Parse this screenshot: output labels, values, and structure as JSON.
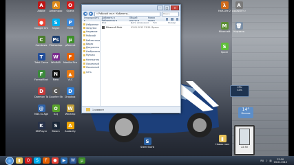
{
  "desktop": {
    "icons": [
      {
        "label": "Adobe",
        "glyph": "A",
        "color": "#c01616"
      },
      {
        "label": "Ashampoo",
        "glyph": "A",
        "color": "#e08b1a"
      },
      {
        "label": "Opera",
        "glyph": "O",
        "color": "#d01a1a"
      },
      {
        "label": "Google Chrome",
        "glyph": "●",
        "color": "#e94335"
      },
      {
        "label": "Skype",
        "glyph": "S",
        "color": "#00aff0"
      },
      {
        "label": "Paint",
        "glyph": "P",
        "color": "#3d88d6"
      },
      {
        "label": "Camtasia",
        "glyph": "C",
        "color": "#4a7d2e"
      },
      {
        "label": "Photoshop",
        "glyph": "Ps",
        "color": "#1b3e6f"
      },
      {
        "label": "µTorrent",
        "glyph": "µ",
        "color": "#3e8f2a"
      },
      {
        "label": "Total Commander",
        "glyph": "T",
        "color": "#224d99"
      },
      {
        "label": "WinRAR",
        "glyph": "W",
        "color": "#7a2c8e"
      },
      {
        "label": "Mozilla Firefox",
        "glyph": "F",
        "color": "#e66000"
      },
      {
        "label": "FormatFactory",
        "glyph": "F",
        "color": "#3b8a3b"
      },
      {
        "label": "Nero",
        "glyph": "N",
        "color": "#111111"
      },
      {
        "label": "VLC",
        "glyph": "▲",
        "color": "#e8780f"
      },
      {
        "label": "Daemon Tools",
        "glyph": "D",
        "color": "#c63a3a"
      },
      {
        "label": "Counter Strike",
        "glyph": "C",
        "color": "#5a5a5a"
      },
      {
        "label": "Dropbox",
        "glyph": "D",
        "color": "#2f7fd6"
      },
      {
        "label": "Mail.ru Agent",
        "glyph": "@",
        "color": "#2e62a8"
      },
      {
        "label": "ICQ",
        "glyph": "✿",
        "color": "#58a32b"
      },
      {
        "label": "Winamp",
        "glyph": "W",
        "color": "#c2a03a"
      },
      {
        "label": "KMPlayer",
        "glyph": "K",
        "color": "#27324a"
      },
      {
        "label": "Steam",
        "glyph": "S",
        "color": "#1b2838"
      },
      {
        "label": "Audacity",
        "glyph": "A",
        "color": "#f0a400"
      }
    ],
    "right_icons": [
      {
        "label": "Half-Life 2",
        "glyph": "λ",
        "color": "#d06a1a"
      },
      {
        "label": "Assassin's Creed",
        "glyph": "A",
        "color": "#7a7a7a"
      },
      {
        "label": "Minecraft",
        "glyph": "M",
        "color": "#5d8f34"
      },
      {
        "label": "Корзина",
        "glyph": "🗑",
        "color": "#7b8fa6"
      },
      {
        "label": "Spore",
        "glyph": "S",
        "color": "#5fbf3a"
      }
    ],
    "car_label": "Shelby GT500",
    "bottom_icon": {
      "label": "Steel Starter Pack Sticks",
      "glyph": "S",
      "color": "#2a5fa0"
    },
    "folder_icon": {
      "label": "Новая папка",
      "glyph": "▮",
      "color": "#e7c25a"
    }
  },
  "explorer": {
    "address": "« Рабочий стол › Кабинеты...",
    "search_placeholder": "Поиск",
    "toolbar": [
      "Упорядочить ▾",
      "Добавить в библиотеку ▾",
      "Общий доступ ▾",
      "Новая папка"
    ],
    "nav_items": [
      {
        "label": "Избранное",
        "gap": false
      },
      {
        "label": "Загрузки",
        "gap": false
      },
      {
        "label": "Недавние",
        "gap": false
      },
      {
        "label": "Рабочий",
        "gap": false
      },
      {
        "label": "Библиотеки",
        "gap": true
      },
      {
        "label": "Видео",
        "gap": false
      },
      {
        "label": "Документы",
        "gap": false
      },
      {
        "label": "Изображения",
        "gap": false
      },
      {
        "label": "Музыка",
        "gap": false
      },
      {
        "label": "Компьютер",
        "gap": true
      },
      {
        "label": "Локальный",
        "gap": false
      },
      {
        "label": "Локальный",
        "gap": false
      },
      {
        "label": "Сеть",
        "gap": true
      }
    ],
    "columns": [
      "Имя",
      "Дата изменения",
      "Тип",
      "Размер"
    ],
    "files": [
      {
        "name": "Minecraft Pack",
        "date": "03.01.2012 23:59",
        "type": "Ярлык"
      }
    ],
    "status": "1 элемент"
  },
  "gadgets": {
    "weather_temp": "14°",
    "weather_city": "Москва",
    "cpu_label": "CPU",
    "cpu_value": "32%",
    "time": "22:50",
    "date": "03.01.2012"
  },
  "taskbar": {
    "apps": [
      {
        "name": "explorer",
        "glyph": "▮",
        "color": "#e7c25a"
      },
      {
        "name": "opera",
        "glyph": "O",
        "color": "#d01a1a"
      },
      {
        "name": "skype",
        "glyph": "S",
        "color": "#00aff0"
      },
      {
        "name": "firefox",
        "glyph": "F",
        "color": "#e66000"
      },
      {
        "name": "chrome",
        "glyph": "●",
        "color": "#e94335"
      },
      {
        "name": "media",
        "glyph": "▶",
        "color": "#2b6fb6"
      },
      {
        "name": "word",
        "glyph": "W",
        "color": "#2b5797"
      },
      {
        "name": "utorrent",
        "glyph": "µ",
        "color": "#3e8f2a"
      }
    ],
    "tray_lang": "RU",
    "time": "22:50",
    "date": "03.01.2012"
  }
}
